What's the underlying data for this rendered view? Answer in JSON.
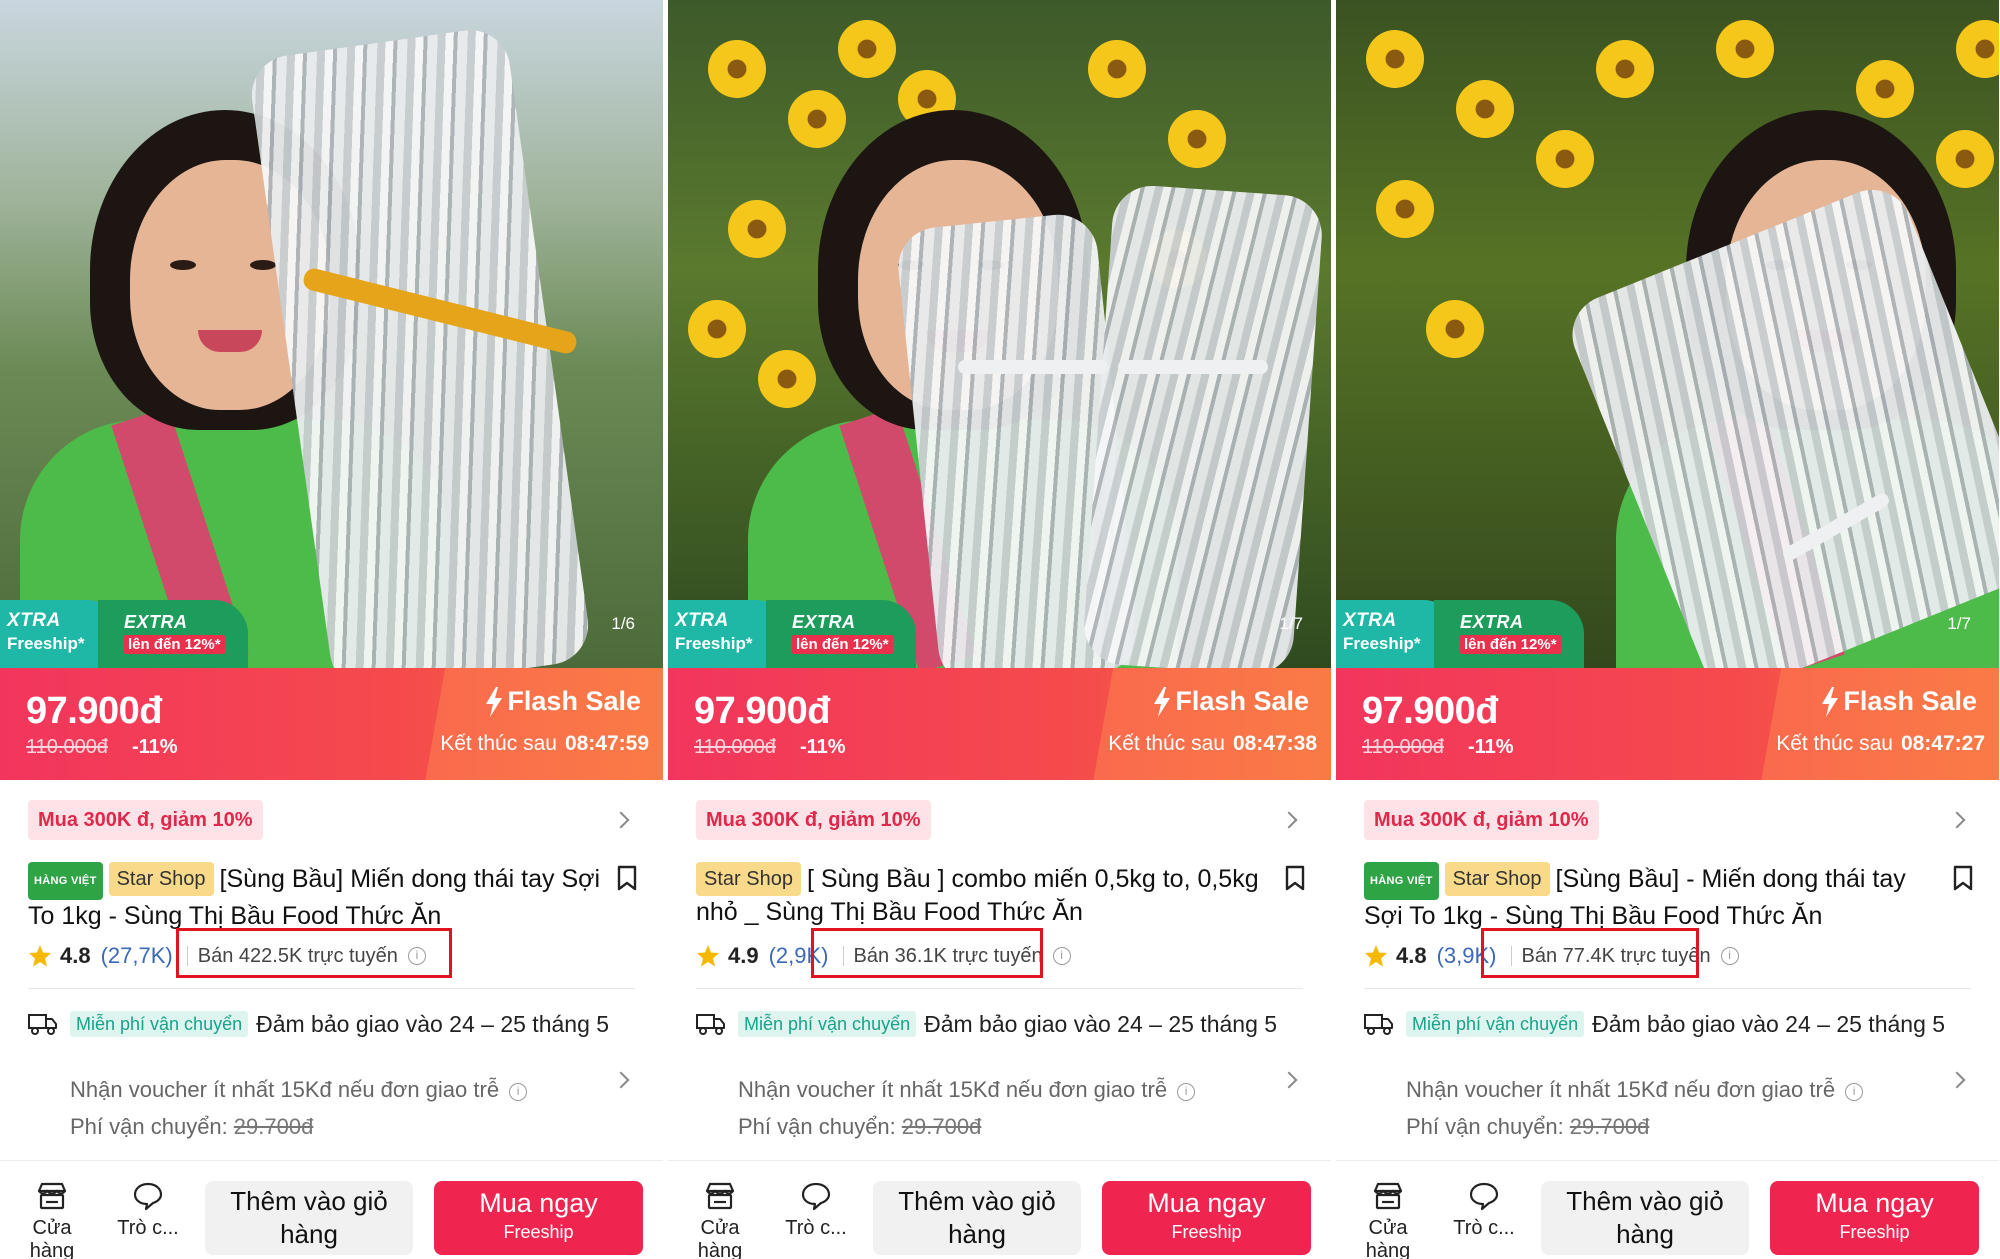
{
  "colors": {
    "price_banner": "#f2355d",
    "buy_button": "#f0254f",
    "free_ship_tag": "#17a38a",
    "highlight_box": "#e0141e",
    "badge_xtra": "#1fb8a6",
    "badge_extra": "#1e9c5b"
  },
  "icons": [
    "bolt-icon",
    "chevron-right-icon",
    "bookmark-icon",
    "star-icon",
    "info-icon",
    "delivery-truck-icon",
    "store-icon",
    "chat-icon"
  ],
  "panels": [
    {
      "image_counter": "1/6",
      "badge_xtra_line1": "XTRA",
      "badge_xtra_line2": "Freeship*",
      "badge_extra_line1": "EXTRA",
      "badge_extra_line2": "lên đến 12%*",
      "price": "97.900đ",
      "old_price": "110.000đ",
      "discount": "-11%",
      "flash_label": "Flash Sale",
      "countdown_label": "Kết thúc sau",
      "countdown_time": "08:47:59",
      "promo": "Mua 300K đ, giảm 10%",
      "tag_hang_viet": "HÀNG VIỆT",
      "tag_star_shop": "Star Shop",
      "title": "[Sùng Bầu] Miến dong thái tay Sợi To 1kg - Sùng Thị Bầu Food Thức Ăn",
      "rating": "4.8",
      "rating_count": "(27,7K)",
      "sold": "Bán 422.5K trực tuyến",
      "free_ship_tag": "Miễn phí vận chuyển",
      "delivery": "Đảm bảo giao vào 24 – 25 tháng 5",
      "voucher": "Nhận voucher ít nhất 15Kđ nếu đơn giao trễ",
      "ship_fee_label": "Phí vận chuyển:",
      "ship_fee": "29.700đ",
      "store_label": "Cửa hàng",
      "chat_label": "Trò c...",
      "cart_label": "Thêm vào giỏ hàng",
      "buy_label": "Mua ngay",
      "buy_sub": "Freeship"
    },
    {
      "image_counter": "1/7",
      "badge_xtra_line1": "XTRA",
      "badge_xtra_line2": "Freeship*",
      "badge_extra_line1": "EXTRA",
      "badge_extra_line2": "lên đến 12%*",
      "price": "97.900đ",
      "old_price": "110.000đ",
      "discount": "-11%",
      "flash_label": "Flash Sale",
      "countdown_label": "Kết thúc sau",
      "countdown_time": "08:47:38",
      "promo": "Mua 300K đ, giảm 10%",
      "tag_hang_viet": "",
      "tag_star_shop": "Star Shop",
      "title": "[ Sùng Bầu ] combo miến 0,5kg to, 0,5kg nhỏ _ Sùng Thị Bầu Food Thức Ăn",
      "rating": "4.9",
      "rating_count": "(2,9K)",
      "sold": "Bán 36.1K trực tuyến",
      "free_ship_tag": "Miễn phí vận chuyển",
      "delivery": "Đảm bảo giao vào 24 – 25 tháng 5",
      "voucher": "Nhận voucher ít nhất 15Kđ nếu đơn giao trễ",
      "ship_fee_label": "Phí vận chuyển:",
      "ship_fee": "29.700đ",
      "store_label": "Cửa hàng",
      "chat_label": "Trò c...",
      "cart_label": "Thêm vào giỏ hàng",
      "buy_label": "Mua ngay",
      "buy_sub": "Freeship"
    },
    {
      "image_counter": "1/7",
      "badge_xtra_line1": "XTRA",
      "badge_xtra_line2": "Freeship*",
      "badge_extra_line1": "EXTRA",
      "badge_extra_line2": "lên đến 12%*",
      "price": "97.900đ",
      "old_price": "110.000đ",
      "discount": "-11%",
      "flash_label": "Flash Sale",
      "countdown_label": "Kết thúc sau",
      "countdown_time": "08:47:27",
      "promo": "Mua 300K đ, giảm 10%",
      "tag_hang_viet": "HÀNG VIỆT",
      "tag_star_shop": "Star Shop",
      "title": "[Sùng Bầu] - Miến dong thái tay Sợi To 1kg - Sùng Thị Bầu Food Thức Ăn",
      "rating": "4.8",
      "rating_count": "(3,9K)",
      "sold": "Bán 77.4K trực tuyến",
      "free_ship_tag": "Miễn phí vận chuyển",
      "delivery": "Đảm bảo giao vào 24 – 25 tháng 5",
      "voucher": "Nhận voucher ít nhất 15Kđ nếu đơn giao trễ",
      "ship_fee_label": "Phí vận chuyển:",
      "ship_fee": "29.700đ",
      "store_label": "Cửa hàng",
      "chat_label": "Trò c...",
      "cart_label": "Thêm vào giỏ hàng",
      "buy_label": "Mua ngay",
      "buy_sub": "Freeship"
    }
  ]
}
